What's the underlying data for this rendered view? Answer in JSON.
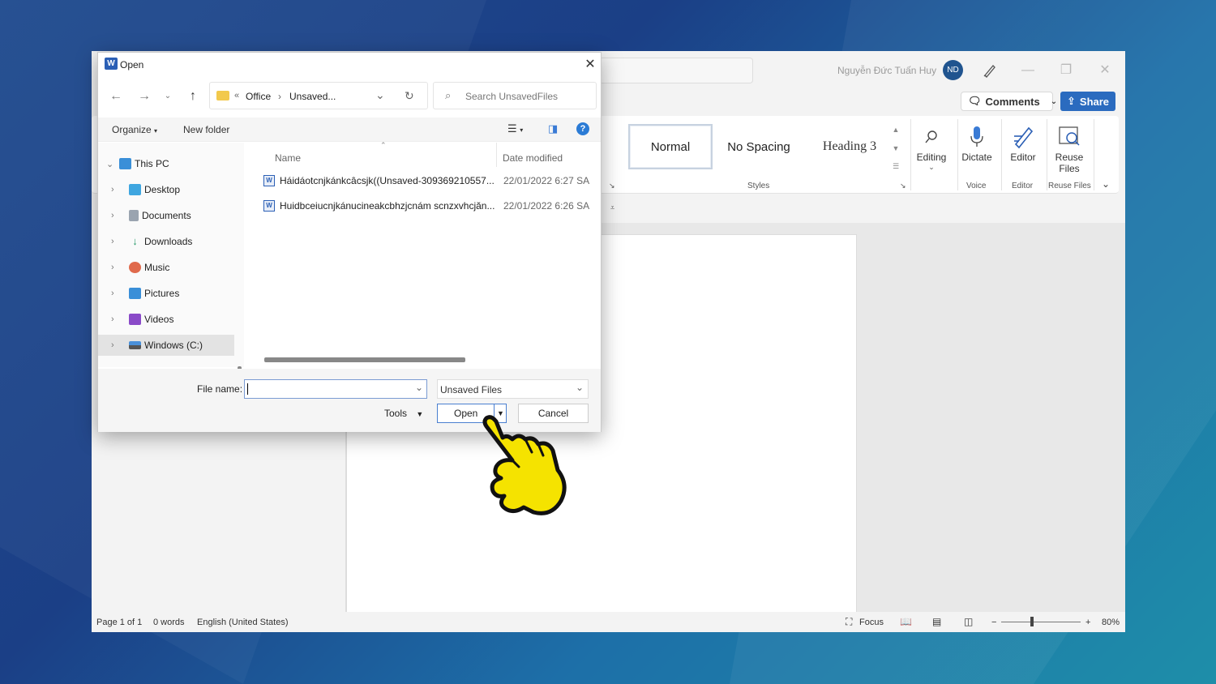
{
  "word": {
    "user_name": "Nguyễn Đức Tuấn Huy",
    "avatar_initials": "ND",
    "comments_label": "Comments",
    "share_label": "Share",
    "styles": [
      "Normal",
      "No Spacing",
      "Heading 3"
    ],
    "styles_group_label": "Styles",
    "editing_label": "Editing",
    "dictate_label": "Dictate",
    "voice_group_label": "Voice",
    "editor_label": "Editor",
    "editor_group_label": "Editor",
    "reuse_label_line1": "Reuse",
    "reuse_label_line2": "Files",
    "reuse_group_label": "Reuse Files",
    "status": {
      "page": "Page 1 of 1",
      "words": "0 words",
      "language": "English (United States)",
      "focus": "Focus",
      "zoom": "80%"
    }
  },
  "dialog": {
    "title": "Open",
    "breadcrumb": [
      "Office",
      "Unsaved..."
    ],
    "search_placeholder": "Search UnsavedFiles",
    "organize_label": "Organize",
    "new_folder_label": "New folder",
    "nav_items": [
      {
        "label": "This PC",
        "icon": "computer-icon"
      },
      {
        "label": "Desktop",
        "icon": "desktop-icon"
      },
      {
        "label": "Documents",
        "icon": "documents-icon"
      },
      {
        "label": "Downloads",
        "icon": "downloads-icon"
      },
      {
        "label": "Music",
        "icon": "music-icon"
      },
      {
        "label": "Pictures",
        "icon": "pictures-icon"
      },
      {
        "label": "Videos",
        "icon": "videos-icon"
      },
      {
        "label": "Windows (C:)",
        "icon": "drive-icon"
      }
    ],
    "columns": {
      "name": "Name",
      "date": "Date modified"
    },
    "files": [
      {
        "name": "Háidáotcnjkánkcâcsjk((Unsaved-309369210557...",
        "date": "22/01/2022 6:27 SA"
      },
      {
        "name": "Huidbceiucnjkánucineakcbhzjcnám scnzxvhcjăn...",
        "date": "22/01/2022 6:26 SA"
      }
    ],
    "file_name_label": "File name:",
    "file_name_value": "",
    "file_type": "Unsaved Files",
    "tools_label": "Tools",
    "open_label": "Open",
    "cancel_label": "Cancel"
  }
}
